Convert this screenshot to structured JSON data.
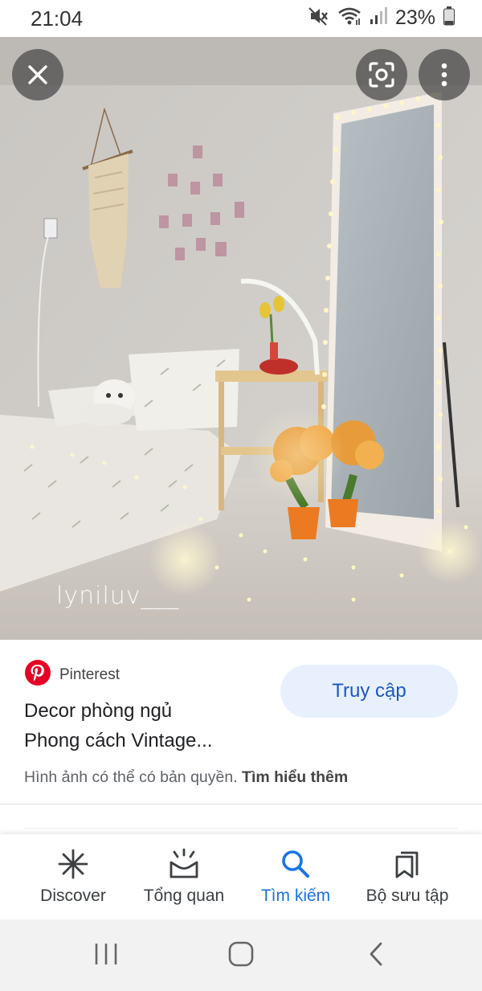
{
  "status_bar": {
    "time": "21:04",
    "battery": "23%",
    "icons": [
      "mute-icon",
      "wifi-icon",
      "signal-icon",
      "battery-icon"
    ]
  },
  "image": {
    "watermark": "lyniluv___",
    "description_icons": [
      "close-icon",
      "lens-icon",
      "more-icon"
    ]
  },
  "result": {
    "source": "Pinterest",
    "title_line1": "Decor phòng ngủ",
    "title_line2": "Phong cách Vintage...",
    "visit_label": "Truy cập",
    "copyright_text": "Hình ảnh có thể có bản quyền.",
    "learn_more": "Tìm hiểu thêm"
  },
  "bottom_nav": {
    "items": [
      {
        "label": "Discover",
        "icon": "asterisk-icon",
        "active": false
      },
      {
        "label": "Tổng quan",
        "icon": "updates-icon",
        "active": false
      },
      {
        "label": "Tìm kiếm",
        "icon": "search-icon",
        "active": true
      },
      {
        "label": "Bộ sưu tập",
        "icon": "collections-icon",
        "active": false
      }
    ]
  },
  "colors": {
    "accent": "#1a73e8",
    "visit_bg": "#e8f0fe",
    "pinterest_red": "#e60023"
  }
}
